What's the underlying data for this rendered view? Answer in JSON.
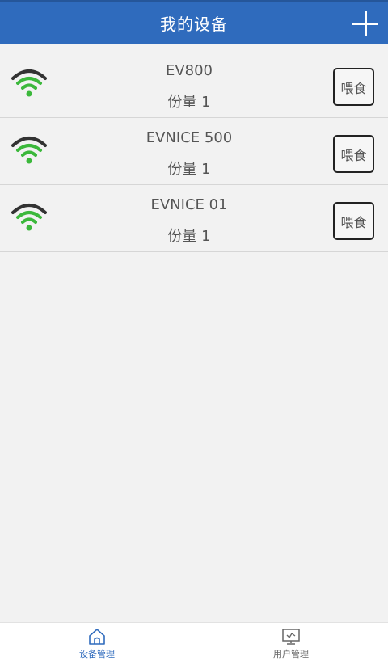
{
  "header": {
    "title": "我的设备",
    "add_icon": "plus-icon"
  },
  "devices": [
    {
      "name": "EV800",
      "portion": "份量 1",
      "feed_label": "喂食",
      "status_icon": "wifi-icon"
    },
    {
      "name": "EVNICE 500",
      "portion": "份量 1",
      "feed_label": "喂食",
      "status_icon": "wifi-icon"
    },
    {
      "name": "EVNICE 01",
      "portion": "份量 1",
      "feed_label": "喂食",
      "status_icon": "wifi-icon"
    }
  ],
  "bottom_nav": [
    {
      "label": "设备管理",
      "icon": "home-icon",
      "active": true
    },
    {
      "label": "用户管理",
      "icon": "monitor-icon",
      "active": false
    }
  ],
  "colors": {
    "primary": "#2f6bbd",
    "wifi_green": "#3bb83b",
    "wifi_dark": "#333333"
  }
}
